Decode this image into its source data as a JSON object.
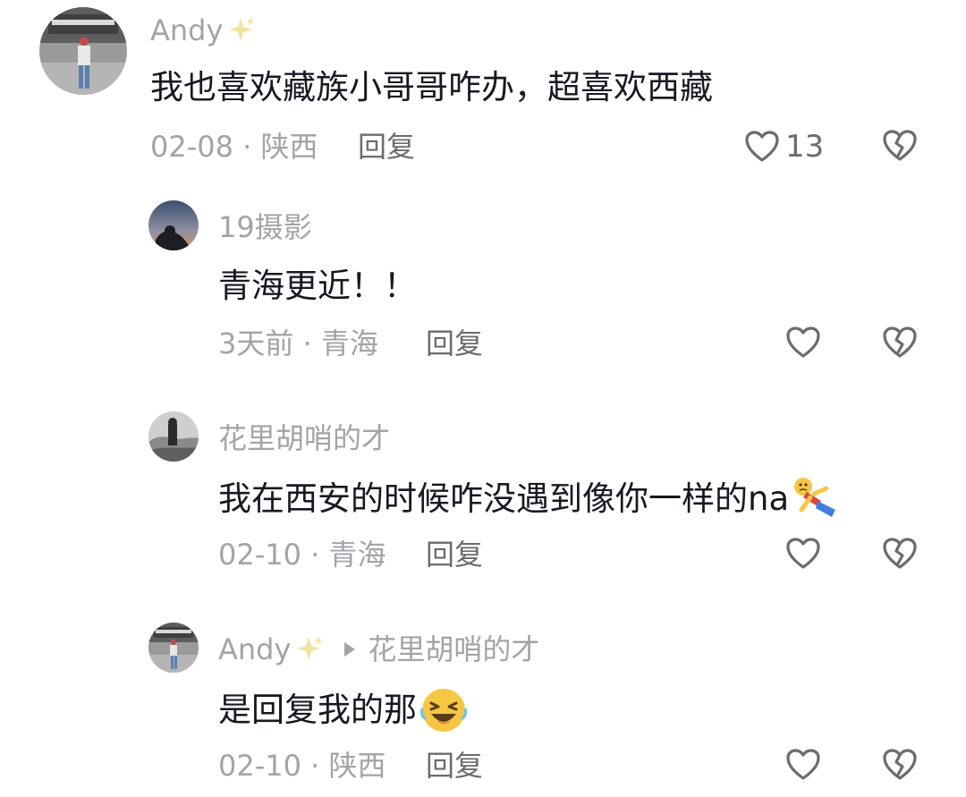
{
  "comments": [
    {
      "username": "Andy",
      "text": "我也喜欢藏族小哥哥咋办，超喜欢西藏",
      "meta": "02-08 · 陕西",
      "reply_label": "回复",
      "like_count": "13"
    },
    {
      "username": "19摄影",
      "text": "青海更近！！",
      "meta": "3天前 · 青海",
      "reply_label": "回复"
    },
    {
      "username": "花里胡哨的才",
      "text": "我在西安的时候咋没遇到像你一样的na",
      "meta": "02-10 · 青海",
      "reply_label": "回复"
    },
    {
      "username": "Andy",
      "reply_to": "花里胡哨的才",
      "text": "是回复我的那",
      "meta": "02-10 · 陕西",
      "reply_label": "回复"
    }
  ],
  "icons": {
    "like": "heart-outline-icon",
    "dislike": "broken-heart-icon",
    "sparkle": "sparkle-icon",
    "reply_arrow": "triangle-right-icon",
    "emoji_1": "falling-person-emoji",
    "emoji_2": "laughing-wink-emoji"
  },
  "colors": {
    "text_primary": "#161823",
    "text_secondary": "#a3a3a8",
    "action": "#6b6b70"
  }
}
